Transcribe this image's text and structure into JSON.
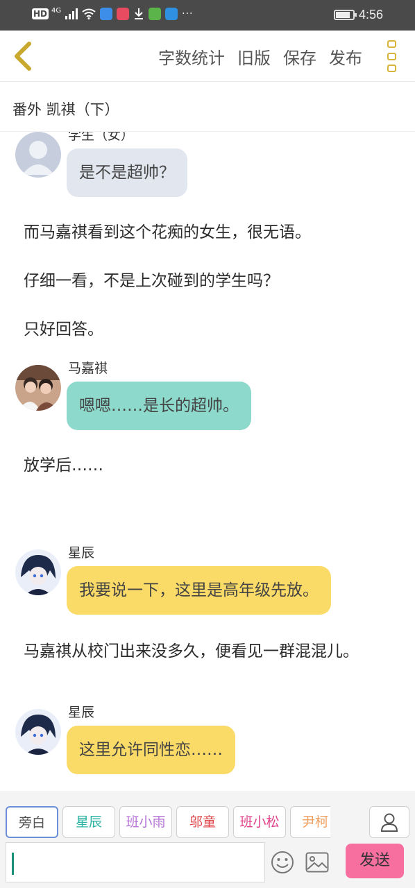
{
  "status_bar": {
    "hd": "HD",
    "network": "4G",
    "more": "···",
    "time": "4:56",
    "battery_level": 0.85,
    "app_icon_colors": [
      "#3d8ee8",
      "#e84a5f",
      "#ffffff",
      "#5ab44a",
      "#2f8fe0"
    ]
  },
  "toolbar": {
    "word_count": "字数统计",
    "old_version": "旧版",
    "save": "保存",
    "publish": "发布",
    "accent_color": "#d9b43a"
  },
  "chapter": {
    "title": "番外   凯祺（下）"
  },
  "story": [
    {
      "type": "message",
      "speaker": "学生（女）",
      "text": "是不是超帅？",
      "bubble_color": "#e2e7ef",
      "avatar": "default"
    },
    {
      "type": "narration",
      "text": "而马嘉祺看到这个花痴的女生，很无语。"
    },
    {
      "type": "narration",
      "text": "仔细一看，不是上次碰到的学生吗？"
    },
    {
      "type": "narration",
      "text": "只好回答。"
    },
    {
      "type": "message",
      "speaker": "马嘉祺",
      "text": "嗯嗯……是长的超帅。",
      "bubble_color": "#8dd9cc",
      "avatar": "photo"
    },
    {
      "type": "narration",
      "text": "放学后……"
    },
    {
      "type": "message",
      "speaker": "星辰",
      "text": "我要说一下，这里是高年级先放。",
      "bubble_color": "#fbdb68",
      "avatar": "anime"
    },
    {
      "type": "narration",
      "text": "马嘉祺从校门出来没多久，便看见一群混混儿。"
    },
    {
      "type": "message",
      "speaker": "星辰",
      "text": "这里允许同性恋……",
      "bubble_color": "#fbdb68",
      "avatar": "anime"
    }
  ],
  "characters": [
    {
      "label": "旁白",
      "color": "#555555",
      "selected": true
    },
    {
      "label": "星辰",
      "color": "#2bb3a3",
      "selected": false
    },
    {
      "label": "班小雨",
      "color": "#b673d6",
      "selected": false
    },
    {
      "label": "邬童",
      "color": "#e0454a",
      "selected": false
    },
    {
      "label": "班小松",
      "color": "#e0408a",
      "selected": false
    },
    {
      "label": "尹柯",
      "color": "#f0a060",
      "selected": false
    }
  ],
  "composer": {
    "input_value": "",
    "send_label": "发送",
    "send_color": "#f66f9f"
  }
}
